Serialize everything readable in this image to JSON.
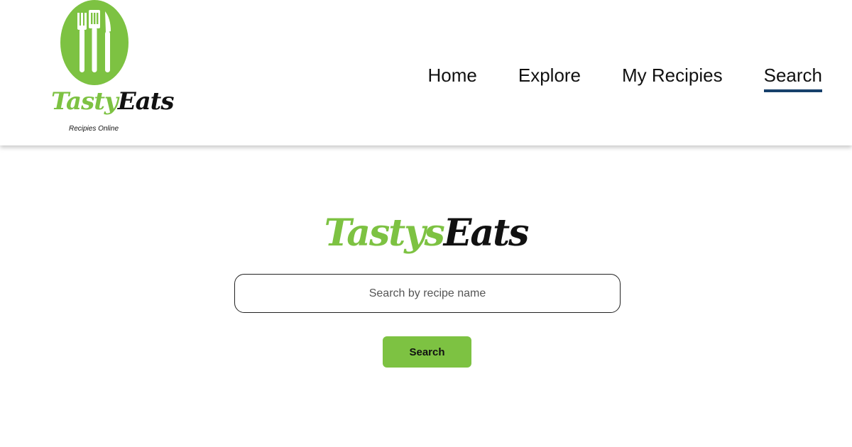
{
  "brand": {
    "logo_word_green": "Tasty",
    "logo_word_black": "Eats",
    "tagline": "Recipies Online",
    "hero_word_green": "Tastys",
    "hero_word_black": "Eats",
    "green_color": "#7dc242",
    "black_color": "#111111"
  },
  "nav": {
    "items": [
      {
        "label": "Home",
        "active": false
      },
      {
        "label": "Explore",
        "active": false
      },
      {
        "label": "My Recipies",
        "active": false
      },
      {
        "label": "Search",
        "active": true
      }
    ],
    "active_underline_color": "#17406b"
  },
  "search": {
    "placeholder": "Search by recipe name",
    "value": "",
    "button_label": "Search"
  },
  "icons": {
    "logo_icon": "fork-spatula-knife-icon"
  }
}
